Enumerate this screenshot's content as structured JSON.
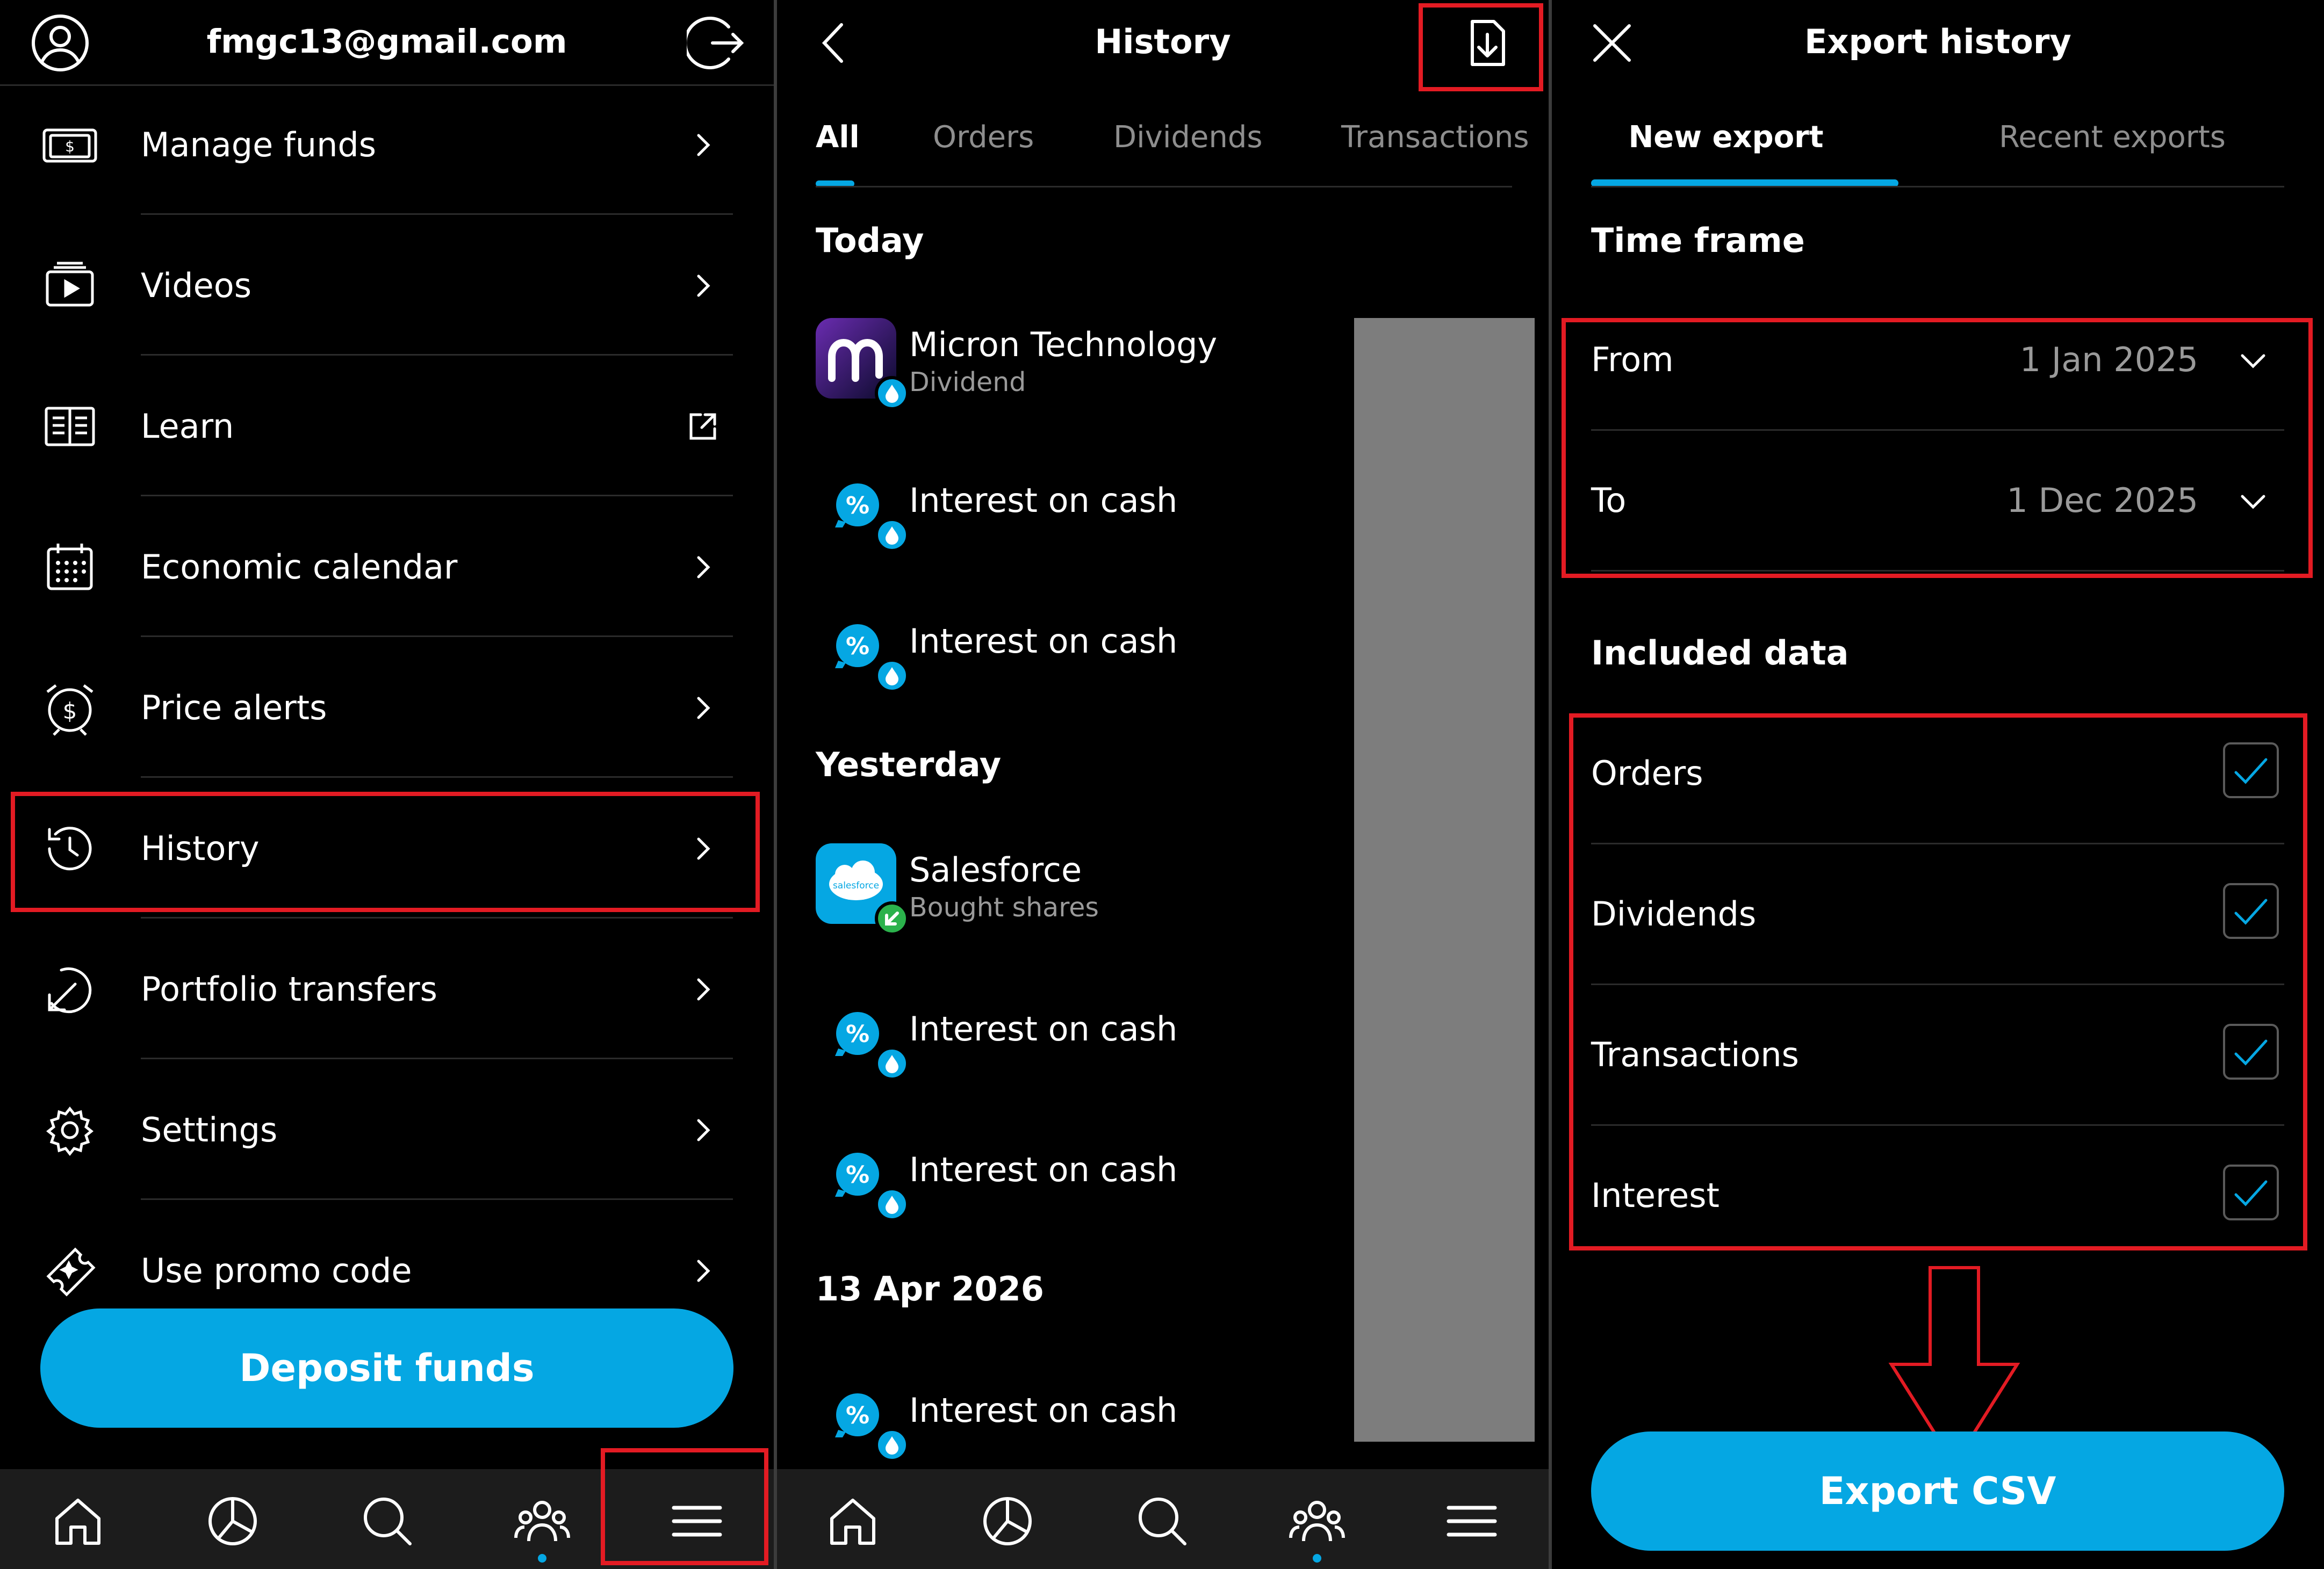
{
  "colors": {
    "accent": "#05a7e3",
    "highlight": "#e31b23",
    "background": "#000000",
    "nav_bg": "#1c1c1c"
  },
  "menu_panel": {
    "email": "fmgc13@gmail.com",
    "items": [
      {
        "label": "Manage funds",
        "icon": "wallet-icon"
      },
      {
        "label": "Videos",
        "icon": "video-icon"
      },
      {
        "label": "Learn",
        "icon": "book-icon"
      },
      {
        "label": "Economic calendar",
        "icon": "calendar-icon"
      },
      {
        "label": "Price alerts",
        "icon": "alarm-icon"
      },
      {
        "label": "History",
        "icon": "history-icon"
      },
      {
        "label": "Portfolio transfers",
        "icon": "transfer-icon"
      },
      {
        "label": "Settings",
        "icon": "gear-icon"
      },
      {
        "label": "Use promo code",
        "icon": "ticket-icon"
      }
    ],
    "deposit_button": "Deposit funds"
  },
  "history_panel": {
    "title": "History",
    "tabs": [
      "All",
      "Orders",
      "Dividends",
      "Transactions"
    ],
    "active_tab": "All",
    "sections": [
      {
        "heading": "Today",
        "items": [
          {
            "title": "Micron Technology",
            "subtitle": "Dividend",
            "avatar": "micron-logo"
          },
          {
            "title": "Interest on cash",
            "subtitle": "",
            "avatar": "piggy-bank-icon"
          },
          {
            "title": "Interest on cash",
            "subtitle": "",
            "avatar": "piggy-bank-icon"
          }
        ]
      },
      {
        "heading": "Yesterday",
        "items": [
          {
            "title": "Salesforce",
            "subtitle": "Bought shares",
            "avatar": "salesforce-logo",
            "logo_text": "salesforce"
          },
          {
            "title": "Interest on cash",
            "subtitle": "",
            "avatar": "piggy-bank-icon"
          },
          {
            "title": "Interest on cash",
            "subtitle": "",
            "avatar": "piggy-bank-icon"
          }
        ]
      },
      {
        "heading": "13 Apr 2026",
        "items": [
          {
            "title": "Interest on cash",
            "subtitle": "",
            "avatar": "piggy-bank-icon"
          }
        ]
      }
    ]
  },
  "export_panel": {
    "title": "Export history",
    "tabs": [
      "New export",
      "Recent exports"
    ],
    "active_tab": "New export",
    "time_frame_label": "Time frame",
    "from": {
      "label": "From",
      "value": "1 Jan 2025"
    },
    "to": {
      "label": "To",
      "value": "1 Dec 2025"
    },
    "included_data_label": "Included data",
    "options": [
      {
        "label": "Orders",
        "checked": true
      },
      {
        "label": "Dividends",
        "checked": true
      },
      {
        "label": "Transactions",
        "checked": true
      },
      {
        "label": "Interest",
        "checked": true
      }
    ],
    "export_button": "Export CSV"
  },
  "bottom_nav": [
    "home-icon",
    "portfolio-icon",
    "search-icon",
    "community-icon",
    "menu-icon"
  ]
}
